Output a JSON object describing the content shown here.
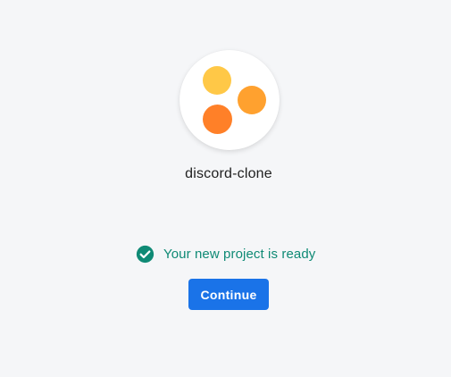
{
  "project": {
    "name": "discord-clone",
    "logo": {
      "icon": "project-logo-dots",
      "colors": {
        "yellow": "#ffc847",
        "orange_right": "#ffa12f",
        "orange_left": "#ff8028"
      }
    }
  },
  "status": {
    "icon": "check-circle-icon",
    "text": "Your new project is ready",
    "color": "#0f8a75"
  },
  "actions": {
    "continue_label": "Continue",
    "continue_color": "#1a73e8"
  }
}
